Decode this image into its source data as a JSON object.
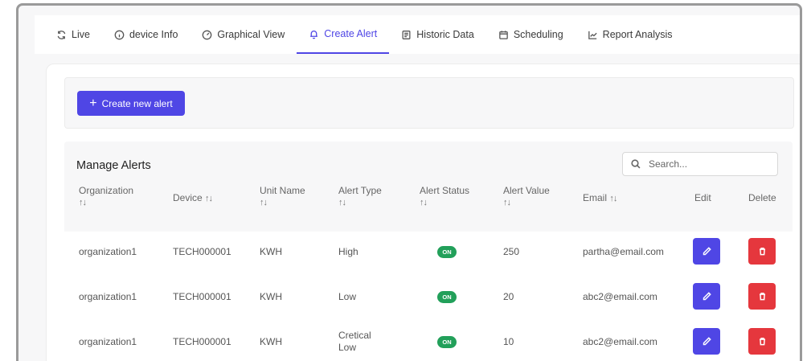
{
  "tabs": [
    {
      "label": "Live",
      "icon": "refresh-icon",
      "active": false
    },
    {
      "label": "device Info",
      "icon": "info-icon",
      "active": false
    },
    {
      "label": "Graphical View",
      "icon": "gauge-icon",
      "active": false
    },
    {
      "label": "Create Alert",
      "icon": "bell-icon",
      "active": true
    },
    {
      "label": "Historic Data",
      "icon": "document-icon",
      "active": false
    },
    {
      "label": "Scheduling",
      "icon": "calendar-icon",
      "active": false
    },
    {
      "label": "Report Analysis",
      "icon": "line-chart-icon",
      "active": false
    }
  ],
  "create": {
    "label": "Create new alert",
    "plus": "+"
  },
  "manage": {
    "title": "Manage Alerts"
  },
  "search": {
    "placeholder": "Search...",
    "value": ""
  },
  "table": {
    "sort_glyph": "↑↓",
    "columns": [
      {
        "label": "Organization",
        "sortable": true
      },
      {
        "label": "Device",
        "sortable": true
      },
      {
        "label": "Unit Name",
        "sortable": true
      },
      {
        "label": "Alert Type",
        "sortable": true
      },
      {
        "label": "Alert Status",
        "sortable": true
      },
      {
        "label": "Alert Value",
        "sortable": true
      },
      {
        "label": "Email",
        "sortable": true
      },
      {
        "label": "Edit",
        "sortable": false
      },
      {
        "label": "Delete",
        "sortable": false
      }
    ],
    "rows": [
      {
        "organization": "organization1",
        "device": "TECH000001",
        "unit": "KWH",
        "type": "High",
        "status": "ON",
        "value": "250",
        "email": "partha@email.com"
      },
      {
        "organization": "organization1",
        "device": "TECH000001",
        "unit": "KWH",
        "type": "Low",
        "status": "ON",
        "value": "20",
        "email": "abc2@email.com"
      },
      {
        "organization": "organization1",
        "device": "TECH000001",
        "unit": "KWH",
        "type": "Cretical Low",
        "status": "ON",
        "value": "10",
        "email": "abc2@email.com"
      }
    ]
  },
  "colors": {
    "accent": "#4f46e5",
    "danger": "#e5373d",
    "status_on": "#22a05a"
  }
}
